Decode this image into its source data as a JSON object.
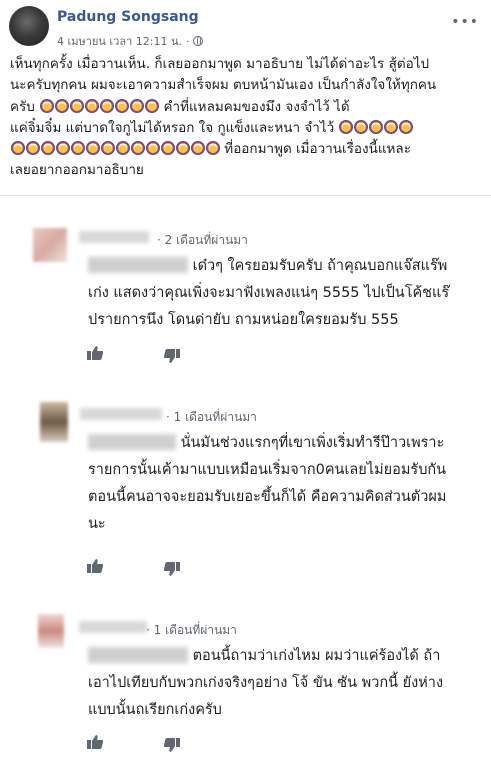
{
  "post": {
    "author": "Padung Songsang",
    "timestamp": "4 เมษายน เวลา 12:11 น.",
    "separator": "·",
    "lines": [
      "เห็นทุกครั้ง เมื่อวานเห็น. ก็เลยออกมาพูด มาอธิบาย ไม่ได้ด่าอะไร สู้ต่อไป",
      "นะครับทุกคน ผมจะเอาความสำเร็จผม ตบหน้ามันเอง เป็นกำลังใจให้ทุกคน",
      "ครับ",
      "คำที่แหลมคมของมึง จงจำไว้ ได้",
      "แค่จิ๋มจิ๋ม แต่บาดใจกูไม่ได้หรอก ใจ กูแข็งและหนา จำไว้",
      "ที่ออกมาพูด เมื่อวานเรื่องนี้แหละ",
      "เลยอยากออกมาอธิบาย"
    ],
    "emoji_icon": "clown-emoji-icon",
    "more_icon": "more-options-icon"
  },
  "comments": [
    {
      "time": "· 2 เดือนที่ผ่านมา",
      "text_first": "เด๋วๆ ใครยอมรับครับ ถ้าคุณบอกแจ๊สแร๊พ",
      "text_rest": [
        "เก่ง แสดงว่าคุณเพิ่งจะมาฟังเพลงแน่ๆ 5555 ไปเป็นโค้ชแร๊",
        "ปรายการนึง โดนด่ายับ ถามหน่อยใครยอมรับ 555"
      ]
    },
    {
      "time": "· 1 เดือนที่ผ่านมา",
      "text_first": "นั่นมันช่วงแรกๆที่เขาเพิ่งเริ่มทำรีป๊าวเพราะ",
      "text_rest": [
        "รายการนั้นเค้ามาแบบเหมือนเริ่มจาก0คนเลยไม่ยอมรับกัน",
        "ตอนนี้คนอาจจะยอมรับเยอะขึ้นก็ได้ คือความคิดส่วนตัวผม",
        "นะ"
      ]
    },
    {
      "time": "· 1 เดือนที่ผ่านมา",
      "text_first": "ตอนนี้ถามว่าเก่งไหม ผมว่าแค่ร้องได้ ถ้า",
      "text_rest": [
        "เอาไปเทียบกับพวกเก่งจริงๆอย่าง โจ้ ขัน ซัน พวกนี้ ยังห่าง",
        "แบบนั้นถเรียกเก่งครับ"
      ]
    }
  ],
  "colors": {
    "author": "#385898",
    "meta": "#606770",
    "text": "#1c1e21"
  }
}
